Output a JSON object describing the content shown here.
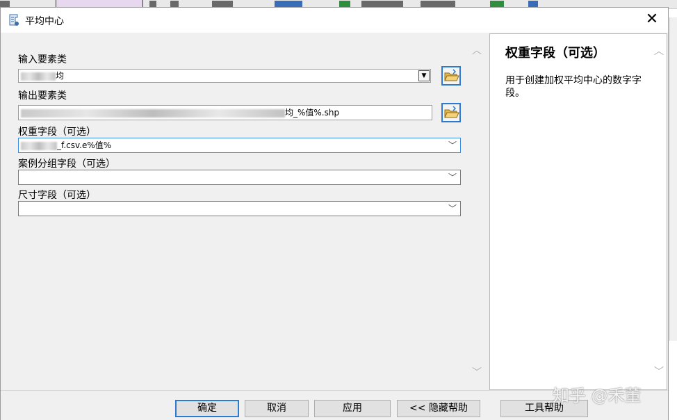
{
  "window": {
    "title": "平均中心",
    "close_glyph": "✕"
  },
  "fields": {
    "input_features": {
      "label": "输入要素类",
      "value_suffix": "均"
    },
    "output_features": {
      "label": "输出要素类",
      "value_suffix": "均_%值%.shp"
    },
    "weight_field": {
      "label": "权重字段（可选）",
      "value_suffix": "_f.csv.e%值%"
    },
    "case_field": {
      "label": "案例分组字段（可选）",
      "value": ""
    },
    "dimension_field": {
      "label": "尺寸字段（可选）",
      "value": ""
    }
  },
  "help": {
    "title": "权重字段（可选）",
    "text": "用于创建加权平均中心的数字字段。"
  },
  "buttons": {
    "ok": "确定",
    "cancel": "取消",
    "apply": "应用",
    "hide_help": "<< 隐藏帮助",
    "tool_help": "工具帮助"
  },
  "watermark": "知乎 @禾董",
  "icons": {
    "title": "script-tool-icon",
    "folder": "open-folder-icon"
  }
}
